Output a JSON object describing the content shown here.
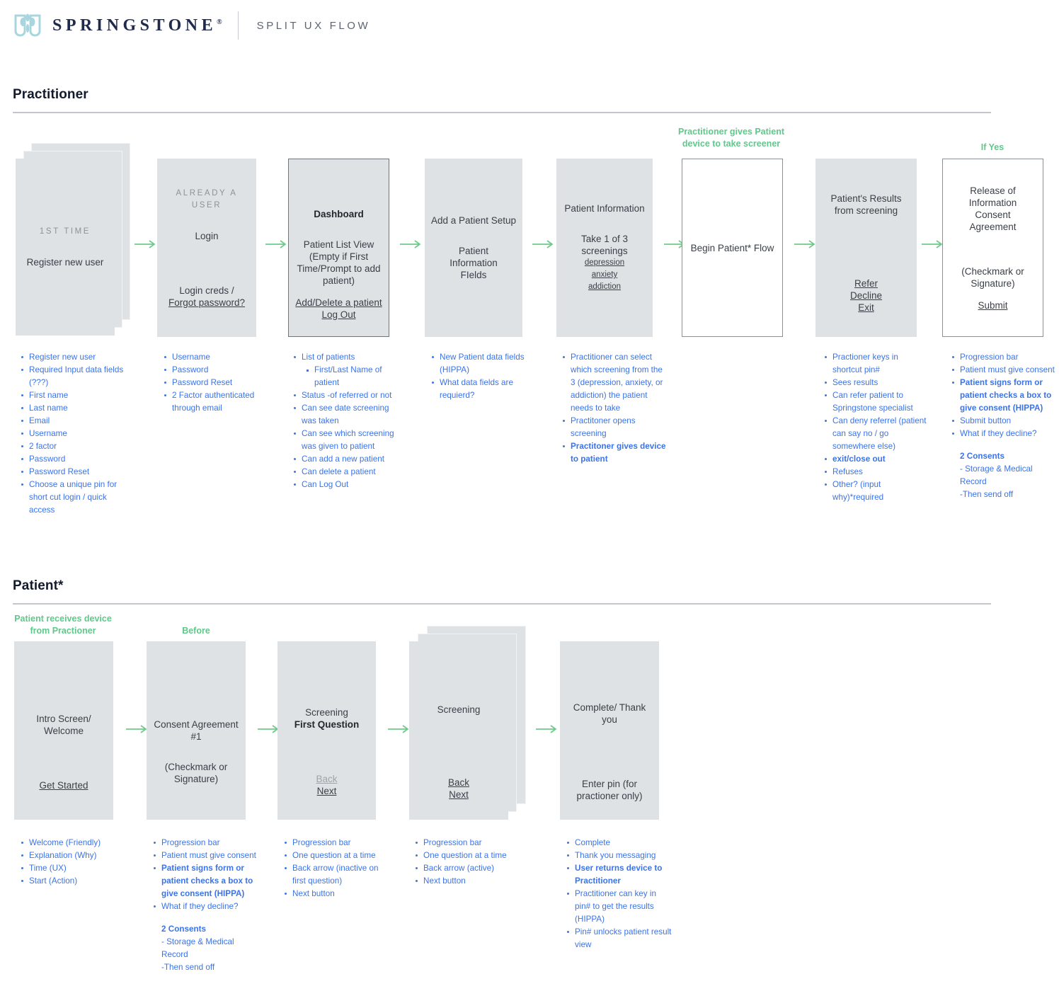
{
  "header": {
    "brand": "SPRINGSTONE",
    "registered_mark": "®",
    "subtitle": "SPLIT UX FLOW",
    "logo_icon": "springstone-butterfly-logo"
  },
  "colors": {
    "accent_green": "#5fc88a",
    "bullet_blue": "#3b73e8",
    "card_fill": "#dfe2e5",
    "brand_navy": "#1f2a4d"
  },
  "practitioner": {
    "section_label": "Practitioner",
    "notes": [
      {
        "text": "Practitioner gives Patient device to take screener"
      },
      {
        "text": "If Yes"
      }
    ],
    "steps": [
      {
        "eyebrow": "1ST TIME",
        "title": "Register new user",
        "bullets": [
          {
            "text": "Register new user"
          },
          {
            "text": "Required Input data fields (???)"
          },
          {
            "text": "First name"
          },
          {
            "text": "Last name"
          },
          {
            "text": "Email"
          },
          {
            "text": "Username"
          },
          {
            "text": "2 factor"
          },
          {
            "text": "Password"
          },
          {
            "text": "Password Reset"
          },
          {
            "text": "Choose a unique pin for short cut login / quick access"
          }
        ]
      },
      {
        "eyebrow": "ALREADY A USER",
        "title": "Login",
        "footer_plain": "Login creds /",
        "footer_link": "Forgot password?",
        "bullets": [
          {
            "text": "Username"
          },
          {
            "text": "Password"
          },
          {
            "text": "Password Reset"
          },
          {
            "text": "2 Factor authenticated through email"
          }
        ]
      },
      {
        "title": "Dashboard",
        "body": "Patient List View (Empty if First Time/Prompt to add patient)",
        "link1": "Add/Delete a patient",
        "link2": "Log Out",
        "bullets": [
          {
            "text": "List of patients"
          },
          {
            "text": "First/Last Name of patient",
            "sub": true
          },
          {
            "text": "Status -of referred or not"
          },
          {
            "text": "Can see date screening was taken"
          },
          {
            "text": "Can see which screening was given to patient"
          },
          {
            "text": "Can add a new patient"
          },
          {
            "text": "Can delete a patient"
          },
          {
            "text": "Can Log Out"
          }
        ]
      },
      {
        "title": "Add a Patient Setup",
        "body": "Patient Information FIelds",
        "bullets": [
          {
            "text": "New Patient data fields (HIPPA)"
          },
          {
            "text": "What data fields are requierd?"
          }
        ]
      },
      {
        "title": "Patient Information",
        "body": "Take 1 of 3 screenings",
        "links": [
          "depression",
          "anxiety",
          "addiction"
        ],
        "bullets": [
          {
            "text": "Practitioner can select which screening from the 3 (depression, anxiety, or addiction) the patient needs to take"
          },
          {
            "text": "Practitoner opens screening"
          },
          {
            "text": "Practitoner gives device to patient",
            "bold": true
          }
        ]
      },
      {
        "title": "Begin Patient* Flow",
        "bullets": []
      },
      {
        "title": "Patient's Results from screening",
        "links": [
          "Refer",
          "Decline",
          "Exit"
        ],
        "bullets": [
          {
            "text": "Practioner keys in shortcut pin#"
          },
          {
            "text": "Sees results"
          },
          {
            "text": "Can refer patient to Springstone specialist"
          },
          {
            "text": "Can deny referrel (patient can say no / go somewhere else)"
          },
          {
            "text": "exit/close out",
            "bold": true
          },
          {
            "text": "Refuses"
          },
          {
            "text": "Other? (input why)*required"
          }
        ]
      },
      {
        "title": "Release of Information Consent Agreement",
        "body": "(Checkmark or Signature)",
        "link1": "Submit",
        "bullets": [
          {
            "text": "Progression bar"
          },
          {
            "text": "Patient must give consent"
          },
          {
            "text": "Patient signs form or patient checks a box to give consent (HIPPA)",
            "bold": true
          },
          {
            "text": "Submit button"
          },
          {
            "text": "What if they decline?"
          }
        ],
        "extra": [
          {
            "text": "2 Consents",
            "head": true
          },
          {
            "text": "- Storage & Medical Record"
          },
          {
            "text": "-Then send off"
          }
        ]
      }
    ]
  },
  "patient": {
    "section_label": "Patient*",
    "notes": [
      {
        "text": "Patient receives device from Practioner"
      },
      {
        "text": "Before"
      }
    ],
    "steps": [
      {
        "title": "Intro Screen/ Welcome",
        "link1": "Get Started",
        "bullets": [
          {
            "text": "Welcome (Friendly)"
          },
          {
            "text": "Explanation (Why)"
          },
          {
            "text": "Time (UX)"
          },
          {
            "text": "Start (Action)"
          }
        ]
      },
      {
        "title": "Consent Agreement #1",
        "body": "(Checkmark or Signature)",
        "bullets": [
          {
            "text": "Progression bar"
          },
          {
            "text": "Patient must give consent"
          },
          {
            "text": "Patient signs form or patient checks a box to give consent (HIPPA)",
            "bold": true
          },
          {
            "text": "What if they decline?"
          }
        ],
        "extra": [
          {
            "text": "2 Consents",
            "head": true
          },
          {
            "text": "- Storage & Medical Record"
          },
          {
            "text": "-Then send off"
          }
        ]
      },
      {
        "title": "Screening",
        "title_bold": "First Question",
        "link_back": "Back",
        "link_next": "Next",
        "back_inactive": true,
        "bullets": [
          {
            "text": "Progression bar"
          },
          {
            "text": "One question at a time"
          },
          {
            "text": "Back arrow (inactive on first question)"
          },
          {
            "text": "Next button"
          }
        ]
      },
      {
        "title": "Screening",
        "link_back": "Back",
        "link_next": "Next",
        "back_inactive": false,
        "bullets": [
          {
            "text": "Progression bar"
          },
          {
            "text": "One question at a time"
          },
          {
            "text": "Back arrow (active)"
          },
          {
            "text": "Next button"
          }
        ]
      },
      {
        "title": "Complete/ Thank you",
        "body": "Enter pin (for practioner only)",
        "bullets": [
          {
            "text": "Complete"
          },
          {
            "text": "Thank you messaging"
          },
          {
            "text": "User returns device to Practitioner",
            "bold": true
          },
          {
            "text": "Practitioner can key in pin# to get the results (HIPPA)"
          },
          {
            "text": "Pin# unlocks patient result view"
          }
        ]
      }
    ]
  }
}
